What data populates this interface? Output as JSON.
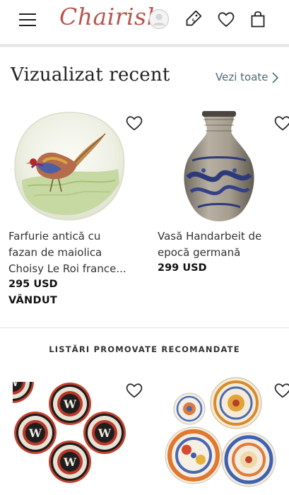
{
  "header": {
    "logo_text": "Chairish",
    "icons": [
      "menu-icon",
      "account-icon",
      "price-tag-icon",
      "heart-icon",
      "shopping-bag-icon"
    ],
    "brand_color": "#b8564f"
  },
  "recently_viewed": {
    "title": "Vizualizat recent",
    "see_all_label": "Vezi toate",
    "items": [
      {
        "title_line1": "Farfurie antică cu",
        "title_line2": "fazan de maiolica",
        "title_line3": "Choisy Le Roi france...",
        "price": "295 USD",
        "status": "VÂNDUT"
      },
      {
        "title_line1": "Vasă Handarbeit de",
        "title_line2": "epocă germană",
        "price": "299 USD"
      }
    ]
  },
  "promoted": {
    "title": "LISTĂRI PROMOVATE RECOMANDATE"
  }
}
